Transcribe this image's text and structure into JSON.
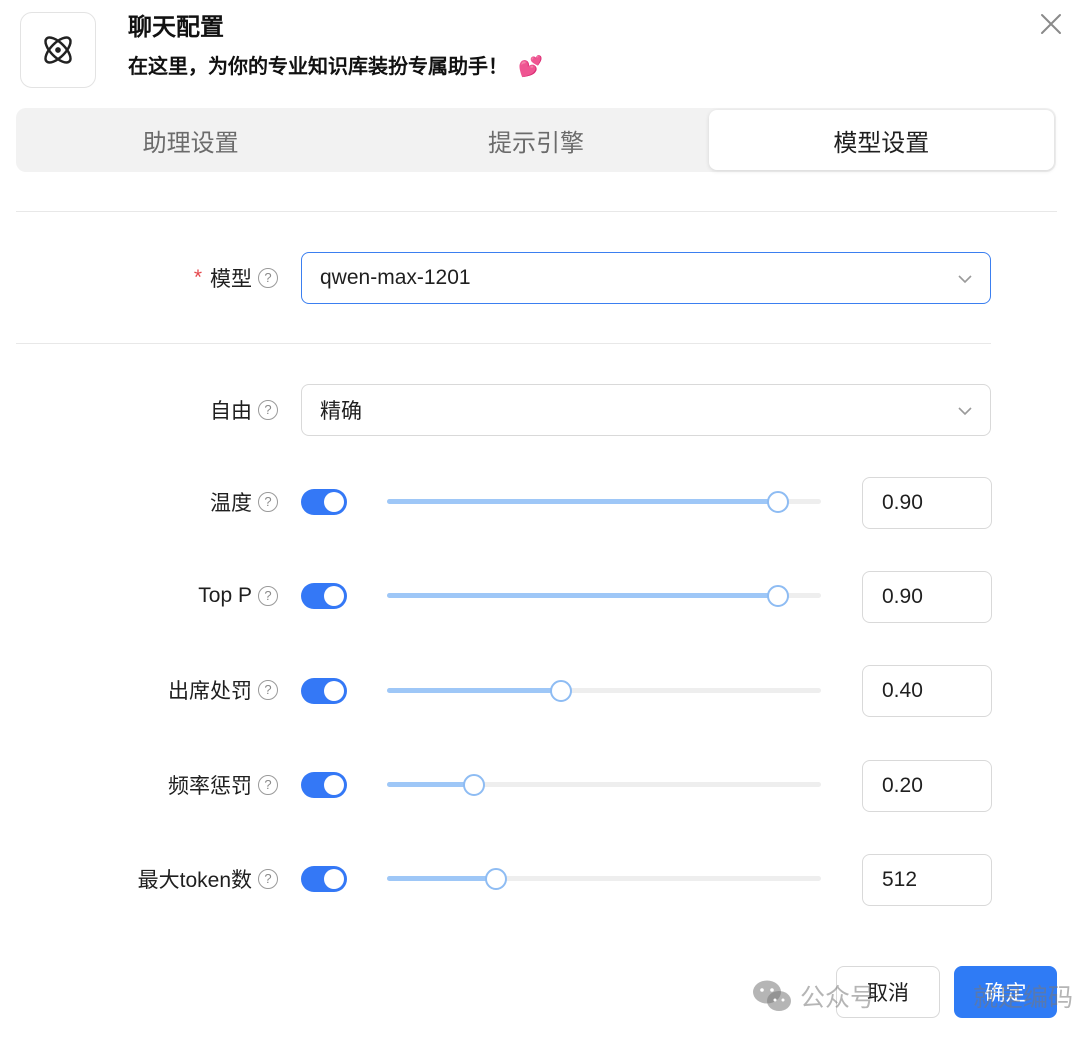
{
  "header": {
    "title": "聊天配置",
    "subtitle": "在这里，为你的专业知识库装扮专属助手！",
    "subtitle_emoji": "💕",
    "app_icon": "atom-icon",
    "close_icon": "close-icon"
  },
  "tabs": [
    {
      "label": "助理设置",
      "active": false
    },
    {
      "label": "提示引擎",
      "active": false
    },
    {
      "label": "模型设置",
      "active": true
    }
  ],
  "form": {
    "model": {
      "label": "模型",
      "required": true,
      "value": "qwen-max-1201"
    },
    "freedom": {
      "label": "自由",
      "value": "精确"
    },
    "params": [
      {
        "key": "temperature",
        "label": "温度",
        "enabled": true,
        "value": "0.90",
        "fraction": 0.9
      },
      {
        "key": "top_p",
        "label": "Top P",
        "enabled": true,
        "value": "0.90",
        "fraction": 0.9
      },
      {
        "key": "presence_penalty",
        "label": "出席处罚",
        "enabled": true,
        "value": "0.40",
        "fraction": 0.4
      },
      {
        "key": "frequency_penalty",
        "label": "频率惩罚",
        "enabled": true,
        "value": "0.20",
        "fraction": 0.2
      },
      {
        "key": "max_tokens",
        "label": "最大token数",
        "enabled": true,
        "value": "512",
        "fraction": 0.25
      }
    ]
  },
  "footer": {
    "cancel_label": "取消",
    "ok_label": "确定"
  },
  "watermark": {
    "prefix": "公众号",
    "author": "就是编码"
  },
  "colors": {
    "accent": "#3478f6",
    "slider_track": "#9ec7f7",
    "required": "#e5484d"
  }
}
